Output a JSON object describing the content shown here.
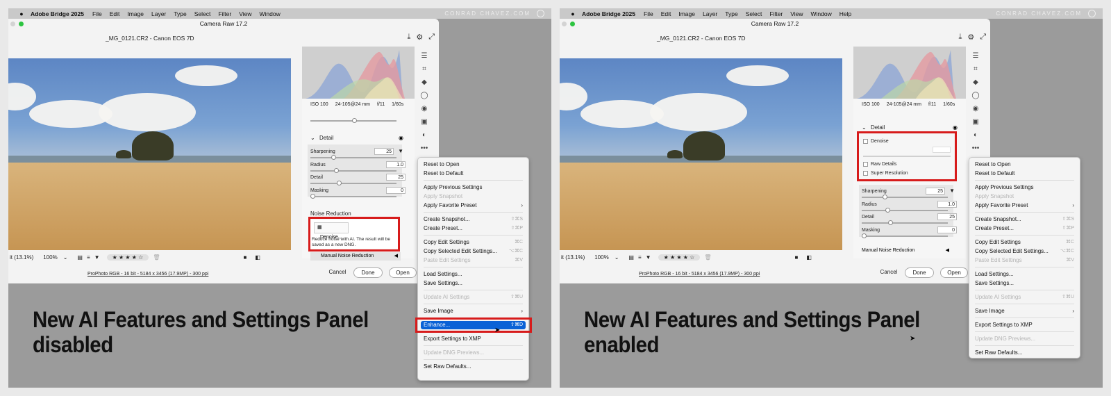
{
  "menubar": {
    "app": "Adobe Bridge 2025",
    "left_items": [
      "File",
      "Edit",
      "Image",
      "Layer",
      "Type",
      "Select",
      "Filter",
      "View",
      "Window"
    ],
    "right_items": [
      "File",
      "Edit",
      "Image",
      "Layer",
      "Type",
      "Select",
      "Filter",
      "View",
      "Window",
      "Help"
    ],
    "brand": "CONRAD CHAVEZ.COM"
  },
  "window": {
    "title": "Camera Raw 17.2",
    "filename": "_MG_0121.CR2  -  Canon EOS 7D",
    "exif": [
      "ISO 100",
      "24-105@24 mm",
      "f/11",
      "1/60s"
    ]
  },
  "detail": {
    "title": "Detail",
    "sharpening_label": "Sharpening",
    "sharpening_val": "25",
    "radius_label": "Radius",
    "radius_val": "1.0",
    "detail_label": "Detail",
    "detail_val": "25",
    "masking_label": "Masking",
    "masking_val": "0"
  },
  "noise": {
    "title": "Noise Reduction",
    "denoise_btn": "Denoise...",
    "denoise_desc": "Reduce noise with AI. The result will be saved as a new DNG.",
    "manual": "Manual Noise Reduction"
  },
  "right_detail": {
    "denoise": "Denoise",
    "raw_details": "Raw Details",
    "super_resolution": "Super Resolution"
  },
  "bottombar": {
    "zoom_fit": "it (13.1%)",
    "zoom": "100%",
    "stars": "★ ★ ★ ★ ☆"
  },
  "footer": {
    "link": "ProPhoto RGB - 16 bit - 5184 x 3456 (17.9MP) - 300 ppi",
    "cancel": "Cancel",
    "done": "Done",
    "open": "Open"
  },
  "menu": {
    "reset_open": "Reset to Open",
    "reset_default": "Reset to Default",
    "apply_previous": "Apply Previous Settings",
    "apply_snapshot": "Apply Snapshot",
    "apply_favorite": "Apply Favorite Preset",
    "create_snapshot": "Create Snapshot...",
    "create_snapshot_sc": "⇧⌘S",
    "create_preset": "Create Preset...",
    "create_preset_sc": "⇧⌘P",
    "copy_edit": "Copy Edit Settings",
    "copy_edit_sc": "⌘C",
    "copy_selected": "Copy Selected Edit Settings...",
    "copy_selected_sc": "⌥⌘C",
    "paste_edit": "Paste Edit Settings",
    "paste_edit_sc": "⌘V",
    "load": "Load Settings...",
    "save": "Save Settings...",
    "update_ai": "Update AI Settings",
    "update_ai_sc": "⇧⌘U",
    "save_image": "Save Image",
    "enhance": "Enhance...",
    "enhance_sc": "⇧⌘D",
    "export_xmp": "Export Settings to XMP",
    "update_dng": "Update DNG Previews...",
    "set_raw": "Set Raw Defaults..."
  },
  "captions": {
    "left_line1": "New AI Features and Settings Panel",
    "left_line2": "disabled",
    "right_line1": "New AI Features and Settings Panel",
    "right_line2": "enabled"
  },
  "colors": {
    "highlight": "#0a62d6",
    "callout": "#d71b1b",
    "backdrop": "#9b9b9b"
  }
}
